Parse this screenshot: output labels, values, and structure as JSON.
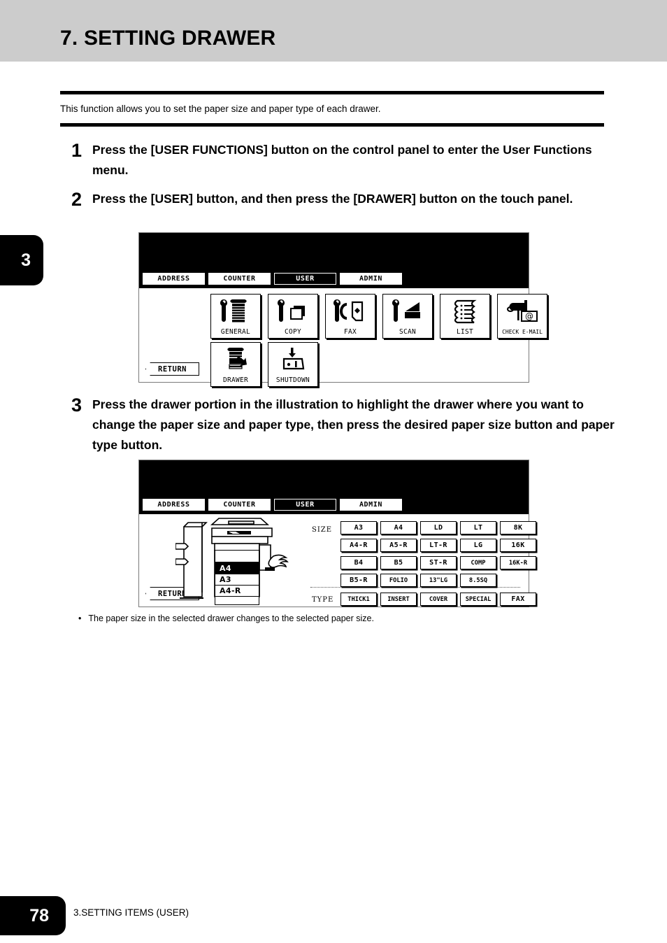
{
  "page": {
    "chapter_title": "7. SETTING DRAWER",
    "chapter_tab": "3",
    "intro": "This function allows you to set the paper size and paper type of each drawer.",
    "note_bullet": "•",
    "note_text": "The paper size in the selected drawer changes to the selected paper size.",
    "page_number": "78",
    "footer_text": "3.SETTING ITEMS (USER)"
  },
  "steps": [
    {
      "num": "1",
      "text": "Press the [USER FUNCTIONS] button on the control panel to enter the User Functions menu."
    },
    {
      "num": "2",
      "text": "Press the [USER] button, and then press the [DRAWER] button on the touch panel."
    },
    {
      "num": "3",
      "text": "Press the drawer portion in the illustration to highlight the drawer where you want to change the paper size and paper type, then press the desired paper size button and paper type button."
    }
  ],
  "panel1": {
    "tabs": [
      {
        "label": "ADDRESS",
        "active": false
      },
      {
        "label": "COUNTER",
        "active": false
      },
      {
        "label": "USER",
        "active": true
      },
      {
        "label": "ADMIN",
        "active": false
      }
    ],
    "return_label": "RETURN",
    "functions": [
      {
        "label": "GENERAL",
        "icon": "wrench-copier-icon"
      },
      {
        "label": "COPY",
        "icon": "wrench-pages-icon"
      },
      {
        "label": "FAX",
        "icon": "wrench-fax-icon"
      },
      {
        "label": "SCAN",
        "icon": "wrench-scanner-icon"
      },
      {
        "label": "LIST",
        "icon": "list-pages-icon"
      },
      {
        "label": "CHECK E-MAIL",
        "icon": "mailbox-at-icon"
      },
      {
        "label": "DRAWER",
        "icon": "copier-drawer-icon"
      },
      {
        "label": "SHUTDOWN",
        "icon": "shutdown-icon"
      }
    ]
  },
  "panel2": {
    "tabs": [
      {
        "label": "ADDRESS",
        "active": false
      },
      {
        "label": "COUNTER",
        "active": false
      },
      {
        "label": "USER",
        "active": true
      },
      {
        "label": "ADMIN",
        "active": false
      }
    ],
    "return_label": "RETURN",
    "size_label": "SIZE",
    "type_label": "TYPE",
    "drawers": [
      {
        "label": "",
        "selected": false
      },
      {
        "label": "A4",
        "selected": true
      },
      {
        "label": "A3",
        "selected": false
      },
      {
        "label": "A4-R",
        "selected": false
      },
      {
        "label": "",
        "selected": false
      }
    ],
    "sizes": [
      "A3",
      "A4",
      "LD",
      "LT",
      "8K",
      "A4-R",
      "A5-R",
      "LT-R",
      "LG",
      "16K",
      "B4",
      "B5",
      "ST-R",
      "COMP",
      "16K-R",
      "B5-R",
      "FOLIO",
      "13\"LG",
      "8.5SQ"
    ],
    "types": [
      "THICK1",
      "INSERT",
      "COVER",
      "SPECIAL",
      "FAX"
    ]
  }
}
